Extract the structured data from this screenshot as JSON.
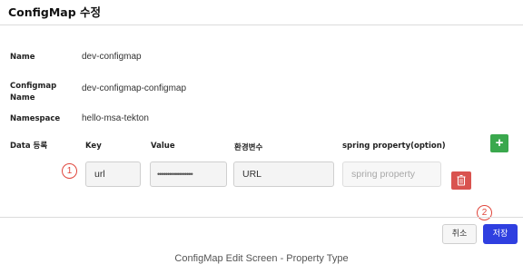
{
  "header": {
    "title": "ConfigMap 수정"
  },
  "form": {
    "name_label": "Name",
    "name_value": "dev-configmap",
    "configmap_name_label_line1": "Configmap",
    "configmap_name_label_line2": "Name",
    "configmap_name_value": "dev-configmap-configmap",
    "namespace_label": "Namespace",
    "namespace_value": "hello-msa-tekton",
    "data_label": "Data 등록"
  },
  "data_table": {
    "columns": [
      "Key",
      "Value",
      "환경변수",
      "spring property(option)"
    ],
    "row": {
      "key": "url",
      "value": "••••••••••••••••••",
      "env": "URL",
      "spring_placeholder": "spring property"
    },
    "add_label": "+"
  },
  "markers": {
    "one": "1",
    "two": "2"
  },
  "footer": {
    "cancel_label": "취소",
    "save_label": "저장"
  },
  "caption": "ConfigMap Edit Screen - Property Type",
  "colors": {
    "add": "#3aa84d",
    "delete": "#d9534f",
    "save": "#2f3fe0",
    "marker": "#e0463c"
  },
  "icons": {
    "add": "plus-icon",
    "delete": "trash-icon"
  }
}
